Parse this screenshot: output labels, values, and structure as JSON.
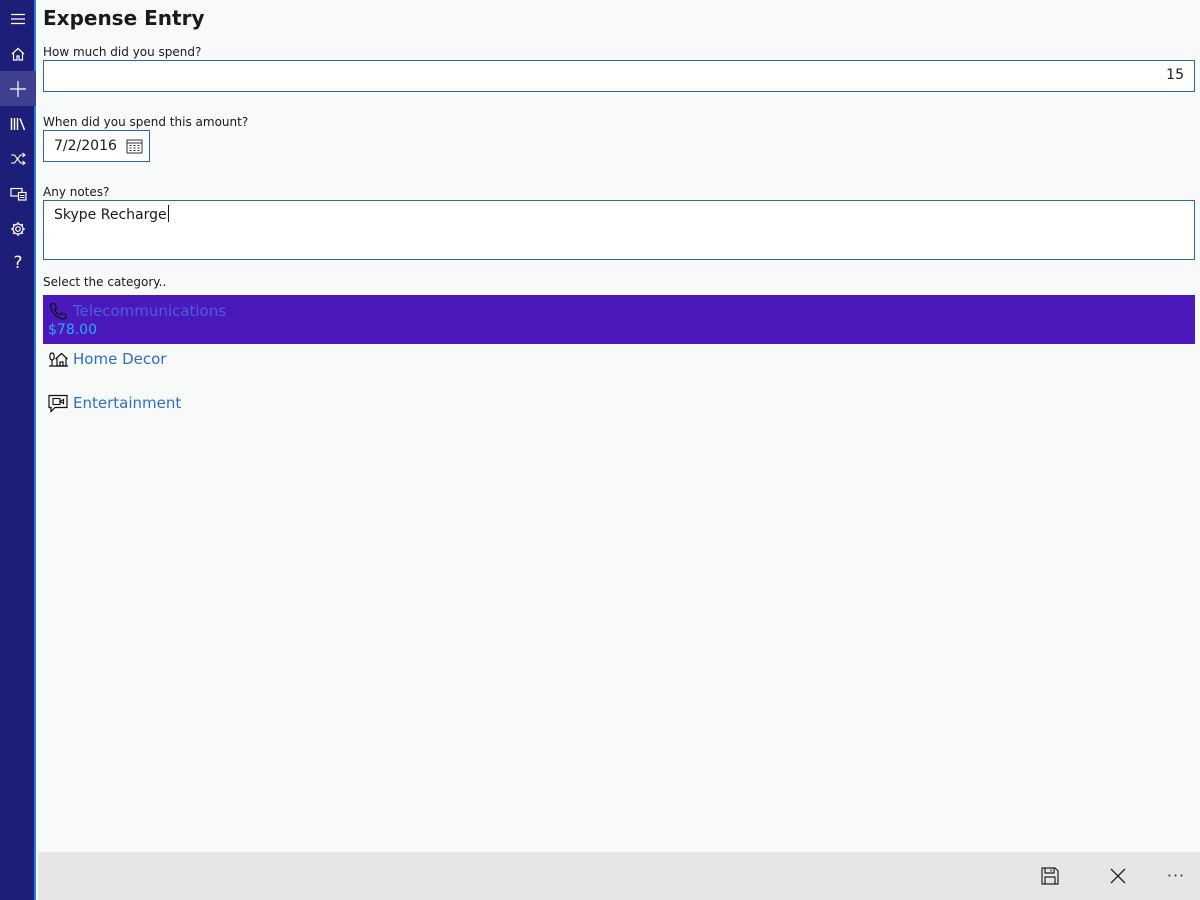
{
  "nav": {
    "items": [
      {
        "icon": "hamburger-menu-icon"
      },
      {
        "icon": "home-icon"
      },
      {
        "icon": "add-icon",
        "active": true
      },
      {
        "icon": "library-icon"
      },
      {
        "icon": "shuffle-icon"
      },
      {
        "icon": "devices-icon"
      },
      {
        "icon": "settings-icon"
      },
      {
        "icon": "help-icon",
        "glyph": "?"
      }
    ],
    "background": "#1d1e78",
    "active_background": "#3f4090"
  },
  "page": {
    "title": "Expense Entry"
  },
  "form": {
    "amount_label": "How much did you spend?",
    "amount_value": "15",
    "date_label": "When did you spend this amount?",
    "date_value": "7/2/2016",
    "notes_label": "Any notes?",
    "notes_value": "Skype Recharge",
    "category_label": "Select the category.."
  },
  "categories": [
    {
      "name": "Telecommunications",
      "icon": "phone-icon",
      "amount": "$78.00",
      "selected": true
    },
    {
      "name": "Home Decor",
      "icon": "home-decor-icon",
      "selected": false
    },
    {
      "name": "Entertainment",
      "icon": "entertainment-icon",
      "selected": false
    }
  ],
  "commands": {
    "save_icon": "save-icon",
    "cancel_icon": "close-icon",
    "more_label": "···"
  },
  "colors": {
    "accent": "#2b6aa8",
    "selected_category": "#4b19bb",
    "link": "#2f6fc1"
  }
}
